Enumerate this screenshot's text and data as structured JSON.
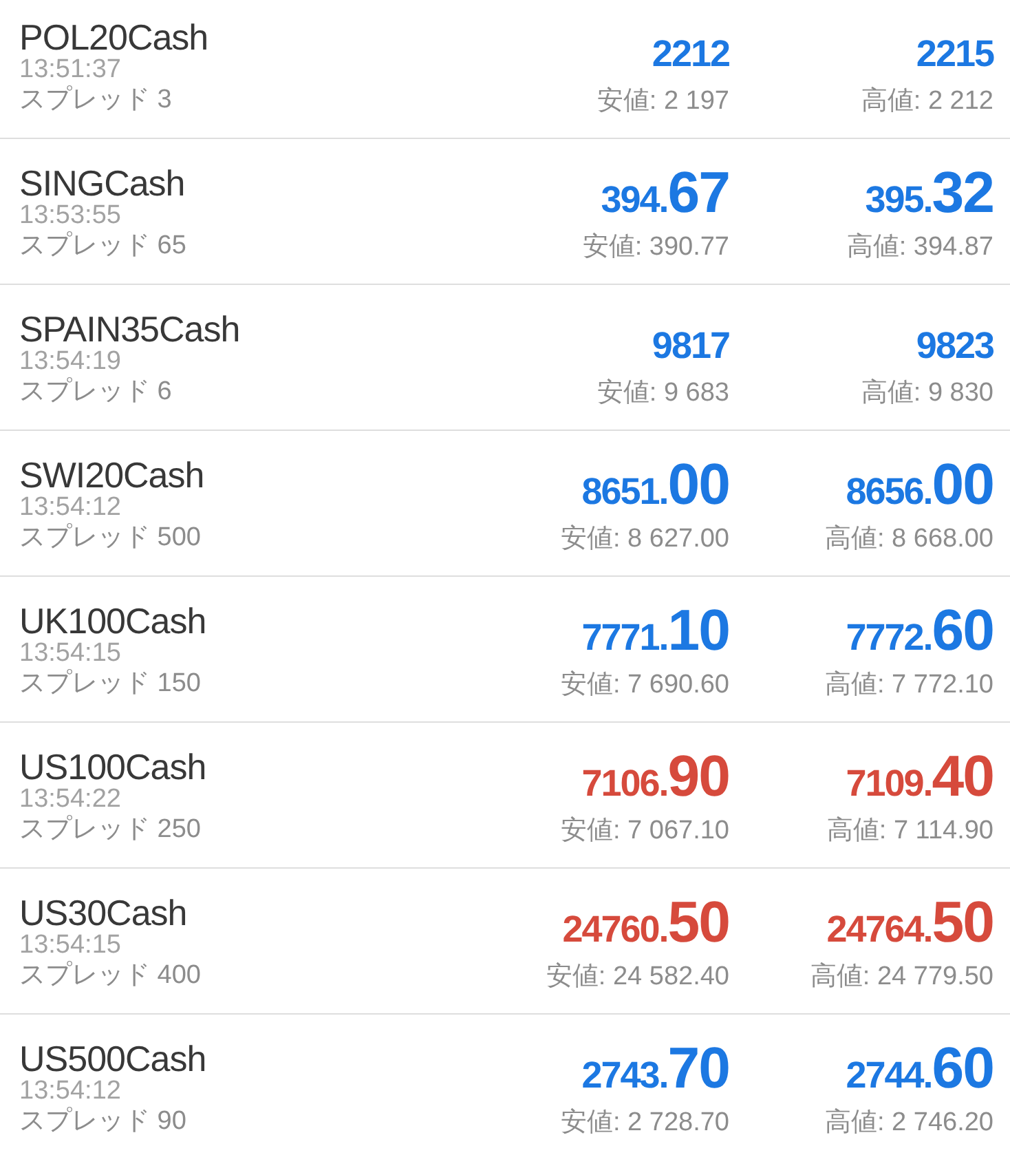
{
  "quotes": [
    {
      "symbol": "POL20Cash",
      "time": "13:51:37",
      "spread": "スプレッド 3",
      "color": "#1c78e2",
      "bid": {
        "main": "2212"
      },
      "ask": {
        "main": "2215"
      },
      "low": "安値: 2 197",
      "high": "高値: 2 212"
    },
    {
      "symbol": "SINGCash",
      "time": "13:53:55",
      "spread": "スプレッド 65",
      "color": "#1c78e2",
      "bid": {
        "main": "394.",
        "pips": "67"
      },
      "ask": {
        "main": "395.",
        "pips": "32"
      },
      "low": "安値: 390.77",
      "high": "高値: 394.87"
    },
    {
      "symbol": "SPAIN35Cash",
      "time": "13:54:19",
      "spread": "スプレッド 6",
      "color": "#1c78e2",
      "bid": {
        "main": "9817"
      },
      "ask": {
        "main": "9823"
      },
      "low": "安値: 9 683",
      "high": "高値: 9 830"
    },
    {
      "symbol": "SWI20Cash",
      "time": "13:54:12",
      "spread": "スプレッド 500",
      "color": "#1c78e2",
      "bid": {
        "main": "8651.",
        "pips": "00"
      },
      "ask": {
        "main": "8656.",
        "pips": "00"
      },
      "low": "安値: 8 627.00",
      "high": "高値: 8 668.00"
    },
    {
      "symbol": "UK100Cash",
      "time": "13:54:15",
      "spread": "スプレッド 150",
      "color": "#1c78e2",
      "bid": {
        "main": "7771.",
        "pips": "10"
      },
      "ask": {
        "main": "7772.",
        "pips": "60"
      },
      "low": "安値: 7 690.60",
      "high": "高値: 7 772.10"
    },
    {
      "symbol": "US100Cash",
      "time": "13:54:22",
      "spread": "スプレッド 250",
      "color": "#d64a3c",
      "bid": {
        "main": "7106.",
        "pips": "90"
      },
      "ask": {
        "main": "7109.",
        "pips": "40"
      },
      "low": "安値: 7 067.10",
      "high": "高値: 7 114.90"
    },
    {
      "symbol": "US30Cash",
      "time": "13:54:15",
      "spread": "スプレッド 400",
      "color": "#d64a3c",
      "bid": {
        "main": "24760.",
        "pips": "50"
      },
      "ask": {
        "main": "24764.",
        "pips": "50"
      },
      "low": "安値: 24 582.40",
      "high": "高値: 24 779.50"
    },
    {
      "symbol": "US500Cash",
      "time": "13:54:12",
      "spread": "スプレッド 90",
      "color": "#1c78e2",
      "bid": {
        "main": "2743.",
        "pips": "70"
      },
      "ask": {
        "main": "2744.",
        "pips": "60"
      },
      "low": "安値: 2 728.70",
      "high": "高値: 2 746.20"
    }
  ]
}
